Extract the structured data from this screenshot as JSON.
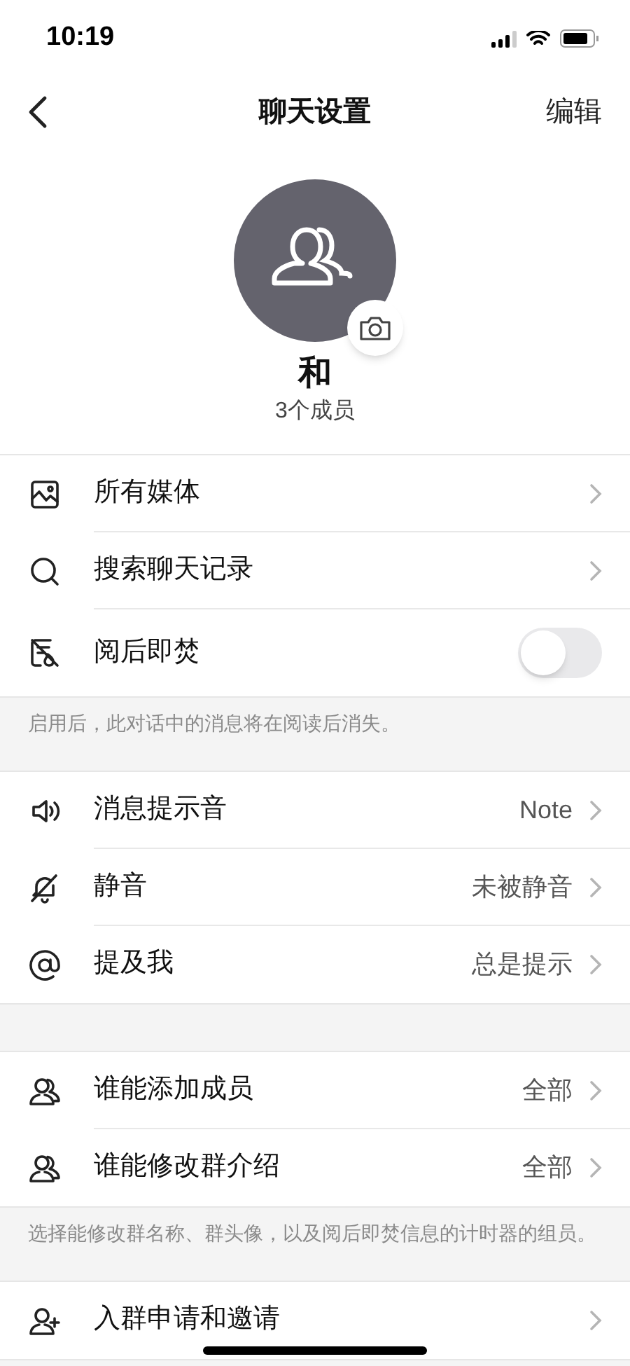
{
  "status_bar": {
    "time": "10:19"
  },
  "nav": {
    "title": "聊天设置",
    "action": "编辑"
  },
  "group": {
    "name": "和",
    "members": "3个成员"
  },
  "sections": [
    {
      "rows": [
        {
          "kind": "link",
          "label": "所有媒体"
        },
        {
          "kind": "link",
          "label": "搜索聊天记录"
        },
        {
          "kind": "toggle",
          "label": "阅后即焚",
          "on": false
        }
      ],
      "footer": "启用后，此对话中的消息将在阅读后消失。"
    },
    {
      "rows": [
        {
          "kind": "link",
          "label": "消息提示音",
          "value": "Note"
        },
        {
          "kind": "link",
          "label": "静音",
          "value": "未被静音"
        },
        {
          "kind": "link",
          "label": "提及我",
          "value": "总是提示"
        }
      ]
    },
    {
      "rows": [
        {
          "kind": "link",
          "label": "谁能添加成员",
          "value": "全部"
        },
        {
          "kind": "link",
          "label": "谁能修改群介绍",
          "value": "全部"
        }
      ],
      "footer": "选择能修改群名称、群头像，以及阅后即焚信息的计时器的组员。"
    },
    {
      "rows": [
        {
          "kind": "link",
          "label": "入群申请和邀请"
        }
      ]
    }
  ]
}
